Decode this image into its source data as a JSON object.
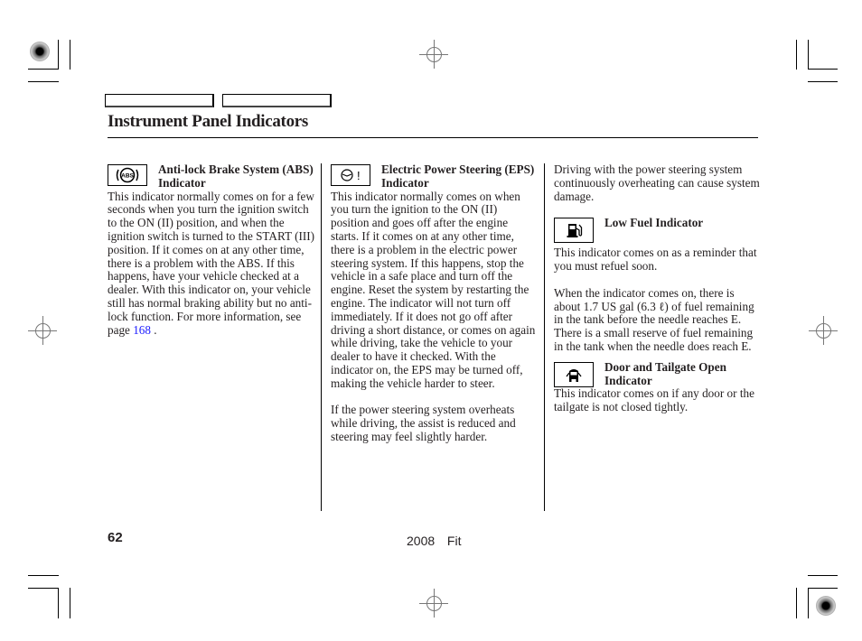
{
  "header": {
    "nav_tabs": [
      "",
      ""
    ],
    "title": "Instrument Panel Indicators"
  },
  "columns": [
    {
      "sections": [
        {
          "icon": "abs-warning-icon",
          "icon_label": "ABS",
          "heading": "Anti-lock Brake System (ABS) Indicator",
          "body": "This indicator normally comes on for a few seconds when you turn the ignition switch to the ON (II) position, and when the ignition switch is turned to the START (III) position. If it comes on at any other time, there is a problem with the ABS. If this happens, have your vehicle checked at a dealer. With this indicator on, your vehicle still has normal braking ability but no anti-lock function. For more information, see page ",
          "link": "168",
          "body_end": " ."
        }
      ]
    },
    {
      "sections": [
        {
          "icon": "eps-warning-icon",
          "icon_label": "!",
          "heading": "Electric Power Steering (EPS) Indicator",
          "body": "This indicator normally comes on when you turn the ignition to the ON (II) position and goes off after the engine starts. If it comes on at any other time, there is a problem in the electric power steering system. If this happens, stop the vehicle in a safe place and turn off the engine. Reset the system by restarting the engine. The indicator will not turn off immediately. If it does not go off after driving a short distance, or comes on again while driving, take the vehicle to your dealer to have it checked. With the indicator on, the EPS may be turned off, making the vehicle harder to steer.",
          "body2": "If the power steering system overheats while driving, the assist is reduced and steering may feel slightly harder."
        }
      ]
    },
    {
      "intro": "Driving with the power steering system continuously overheating can cause system damage.",
      "sections": [
        {
          "icon": "fuel-pump-icon",
          "heading": "Low Fuel Indicator",
          "body": "This indicator comes on as a reminder that you must refuel soon.",
          "body2": "When the indicator comes on, there is about 1.7 US gal (6.3 ℓ) of fuel remaining in the tank before the needle reaches E. There is a small reserve of fuel remaining in the tank when the needle does reach E."
        },
        {
          "icon": "door-open-icon",
          "heading": "Door and Tailgate Open Indicator",
          "body": "This indicator comes on if any door or the tailgate is not closed tightly."
        }
      ]
    }
  ],
  "footer": {
    "page_number": "62",
    "book_title": "2008  Fit"
  }
}
